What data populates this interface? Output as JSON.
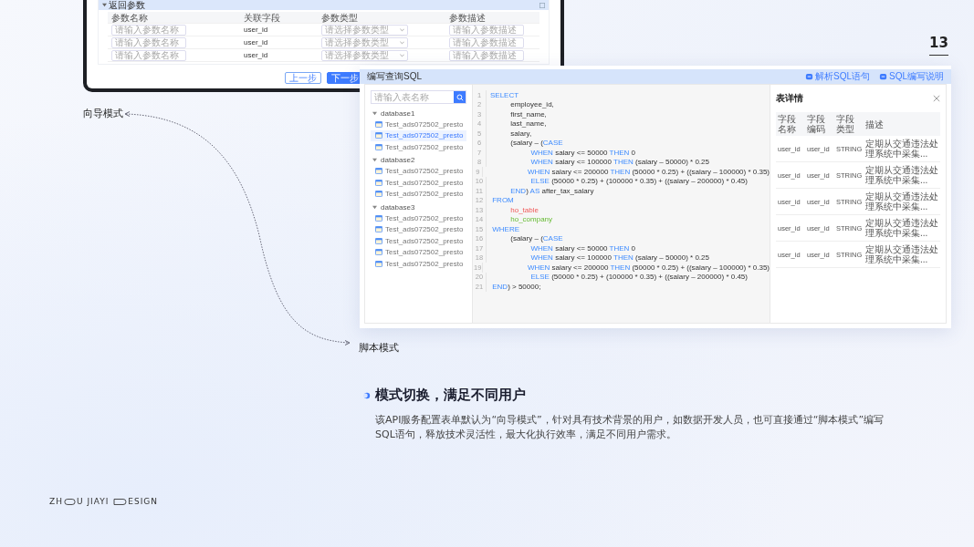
{
  "page_number": "13",
  "wizard_screen": {
    "section_title": "返回参数",
    "columns": [
      "参数名称",
      "关联字段",
      "参数类型",
      "参数描述"
    ],
    "rows": [
      {
        "name_placeholder": "请输入参数名称",
        "field": "user_id",
        "type_placeholder": "请选择参数类型",
        "desc_placeholder": "请输入参数描述"
      },
      {
        "name_placeholder": "请输入参数名称",
        "field": "user_id",
        "type_placeholder": "请选择参数类型",
        "desc_placeholder": "请输入参数描述"
      },
      {
        "name_placeholder": "请输入参数名称",
        "field": "user_id",
        "type_placeholder": "请选择参数类型",
        "desc_placeholder": "请输入参数描述"
      }
    ],
    "buttons": [
      {
        "label": "上一步",
        "kind": "secondary"
      },
      {
        "label": "下一步",
        "kind": "primary"
      }
    ]
  },
  "sql_editor": {
    "title": "编写查询SQL",
    "actions": [
      "解析SQL语句",
      "SQL编写说明"
    ],
    "search": {
      "placeholder": "请输入表名称"
    },
    "tree": [
      {
        "label": "database1",
        "expanded": true,
        "children": [
          {
            "label": "Test_ads072502_presto",
            "selected": false
          },
          {
            "label": "Test_ads072502_presto",
            "selected": true
          },
          {
            "label": "Test_ads072502_presto",
            "selected": false
          }
        ]
      },
      {
        "label": "database2",
        "expanded": true,
        "children": [
          {
            "label": "Test_ads072502_presto",
            "selected": false
          },
          {
            "label": "Test_ads072502_presto",
            "selected": false
          },
          {
            "label": "Test_ads072502_presto",
            "selected": false
          }
        ]
      },
      {
        "label": "database3",
        "expanded": true,
        "children": [
          {
            "label": "Test_ads072502_presto",
            "selected": false
          },
          {
            "label": "Test_ads072502_presto",
            "selected": false
          },
          {
            "label": "Test_ads072502_presto",
            "selected": false
          },
          {
            "label": "Test_ads072502_presto",
            "selected": false
          },
          {
            "label": "Test_ads072502_presto",
            "selected": false
          }
        ]
      }
    ],
    "code_lines": [
      {
        "number": "1",
        "tokens": [
          {
            "text": "SELECT",
            "kind": "keyword"
          }
        ]
      },
      {
        "number": "2",
        "tokens": [
          {
            "text": "          employee_id,",
            "kind": "plain"
          }
        ]
      },
      {
        "number": "3",
        "tokens": [
          {
            "text": "          first_name,",
            "kind": "plain"
          }
        ]
      },
      {
        "number": "4",
        "tokens": [
          {
            "text": "          last_name,",
            "kind": "plain"
          }
        ]
      },
      {
        "number": "5",
        "tokens": [
          {
            "text": "          salary,",
            "kind": "plain"
          }
        ]
      },
      {
        "number": "6",
        "tokens": [
          {
            "text": "          (salary – (",
            "kind": "plain"
          },
          {
            "text": "CASE",
            "kind": "keyword"
          }
        ]
      },
      {
        "number": "7",
        "tokens": [
          {
            "text": "                    WHEN",
            "kind": "keyword"
          },
          {
            "text": " salary <= 50000 ",
            "kind": "plain"
          },
          {
            "text": "THEN",
            "kind": "keyword"
          },
          {
            "text": " 0",
            "kind": "plain"
          }
        ]
      },
      {
        "number": "8",
        "tokens": [
          {
            "text": "                    WHEN",
            "kind": "keyword"
          },
          {
            "text": " salary <= 100000 ",
            "kind": "plain"
          },
          {
            "text": "THEN",
            "kind": "keyword"
          },
          {
            "text": " (salary – 50000) * 0.25",
            "kind": "plain"
          }
        ]
      },
      {
        "number": "9",
        "tokens": [
          {
            "text": "                    WHEN",
            "kind": "keyword"
          },
          {
            "text": " salary <= 200000 ",
            "kind": "plain"
          },
          {
            "text": "THEN",
            "kind": "keyword"
          },
          {
            "text": " (50000 * 0.25) + ((salary – 100000) * 0.35)",
            "kind": "plain"
          }
        ]
      },
      {
        "number": "10",
        "tokens": [
          {
            "text": "                    ELSE",
            "kind": "keyword"
          },
          {
            "text": " (50000 * 0.25) + (100000 * 0.35) + ((salary – 200000) * 0.45)",
            "kind": "plain"
          }
        ]
      },
      {
        "number": "11",
        "tokens": [
          {
            "text": "          END",
            "kind": "keyword"
          },
          {
            "text": ") ",
            "kind": "plain"
          },
          {
            "text": "AS",
            "kind": "keyword"
          },
          {
            "text": " after_tax_salary",
            "kind": "plain"
          }
        ]
      },
      {
        "number": "12",
        "tokens": [
          {
            "text": " FROM",
            "kind": "keyword"
          }
        ]
      },
      {
        "number": "13",
        "tokens": [
          {
            "text": "          ho_table",
            "kind": "table"
          }
        ]
      },
      {
        "number": "14",
        "tokens": [
          {
            "text": "          ho_company",
            "kind": "company"
          }
        ]
      },
      {
        "number": "15",
        "tokens": [
          {
            "text": " WHERE",
            "kind": "keyword"
          }
        ]
      },
      {
        "number": "16",
        "tokens": [
          {
            "text": "          (salary – (",
            "kind": "plain"
          },
          {
            "text": "CASE",
            "kind": "keyword"
          }
        ]
      },
      {
        "number": "17",
        "tokens": [
          {
            "text": "                    WHEN",
            "kind": "keyword"
          },
          {
            "text": " salary <= 50000 ",
            "kind": "plain"
          },
          {
            "text": "THEN",
            "kind": "keyword"
          },
          {
            "text": " 0",
            "kind": "plain"
          }
        ]
      },
      {
        "number": "18",
        "tokens": [
          {
            "text": "                    WHEN",
            "kind": "keyword"
          },
          {
            "text": " salary <= 100000 ",
            "kind": "plain"
          },
          {
            "text": "THEN",
            "kind": "keyword"
          },
          {
            "text": " (salary – 50000) * 0.25",
            "kind": "plain"
          }
        ]
      },
      {
        "number": "19",
        "tokens": [
          {
            "text": "                    WHEN",
            "kind": "keyword"
          },
          {
            "text": " salary <= 200000 ",
            "kind": "plain"
          },
          {
            "text": "THEN",
            "kind": "keyword"
          },
          {
            "text": " (50000 * 0.25) + ((salary – 100000) * 0.35)",
            "kind": "plain"
          }
        ]
      },
      {
        "number": "20",
        "tokens": [
          {
            "text": "                    ELSE",
            "kind": "keyword"
          },
          {
            "text": " (50000 * 0.25) + (100000 * 0.35) + ((salary – 200000) * 0.45)",
            "kind": "plain"
          }
        ]
      },
      {
        "number": "21",
        "tokens": [
          {
            "text": " END",
            "kind": "keyword"
          },
          {
            "text": ") > 50000;",
            "kind": "plain"
          }
        ]
      }
    ],
    "detail": {
      "title": "表详情",
      "columns": [
        "字段名称",
        "字段编码",
        "字段类型",
        "描述"
      ],
      "rows": [
        [
          "user_id",
          "user_id",
          "STRING",
          "定期从交通违法处理系统中采集..."
        ],
        [
          "user_id",
          "user_id",
          "STRING",
          "定期从交通违法处理系统中采集..."
        ],
        [
          "user_id",
          "user_id",
          "STRING",
          "定期从交通违法处理系统中采集..."
        ],
        [
          "user_id",
          "user_id",
          "STRING",
          "定期从交通违法处理系统中采集..."
        ],
        [
          "user_id",
          "user_id",
          "STRING",
          "定期从交通违法处理系统中采集..."
        ]
      ]
    }
  },
  "labels": {
    "wizard": "向导模式",
    "script": "脚本模式"
  },
  "feature": {
    "title": "模式切换，满足不同用户",
    "body": "该API服务配置表单默认为“向导模式”，针对具有技术背景的用户，如数据开发人员，也可直接通过“脚本模式”编写SQL语句，释放技术灵活性，最大化执行效率，满足不同用户需求。"
  },
  "logo": {
    "parts": [
      "ZH",
      "U JIAYI",
      "ESIGN"
    ]
  }
}
